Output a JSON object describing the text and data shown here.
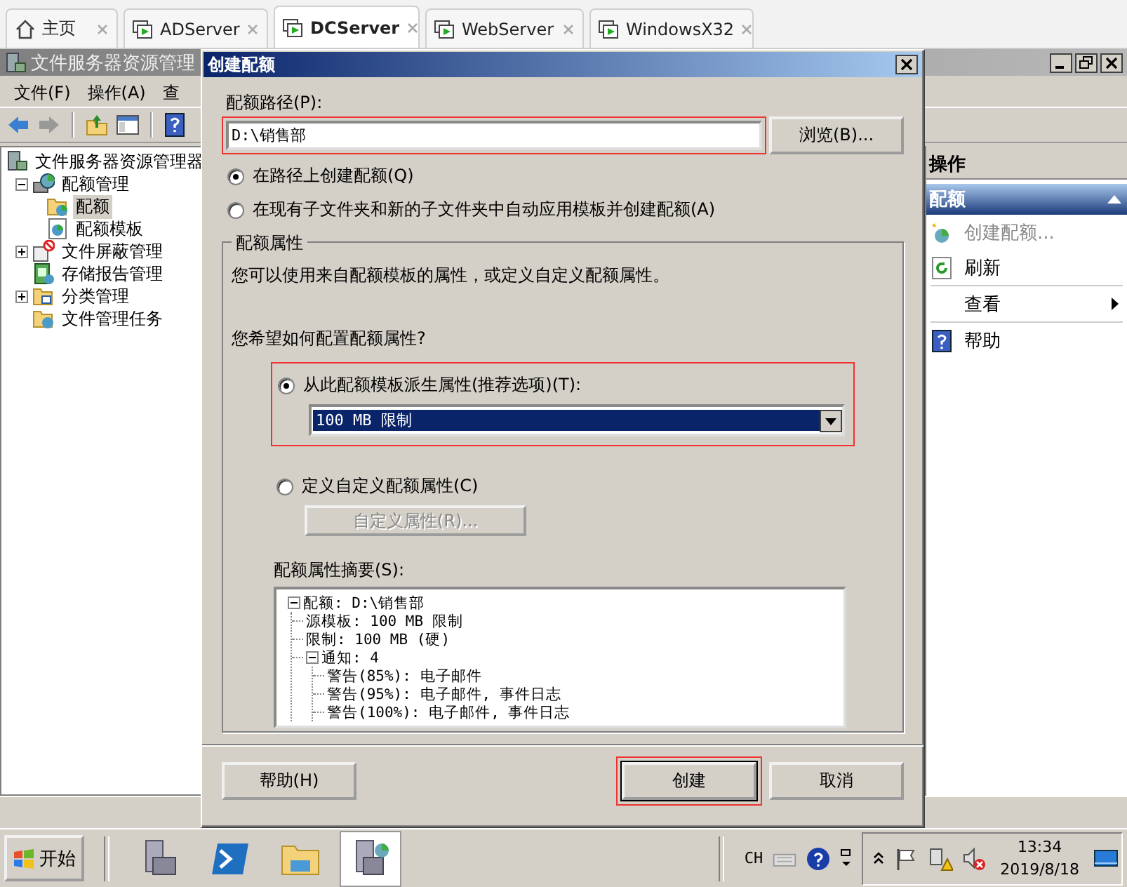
{
  "browser_tabs": [
    {
      "label": "主页",
      "selected": false
    },
    {
      "label": "ADServer",
      "selected": false
    },
    {
      "label": "DCServer",
      "selected": true
    },
    {
      "label": "WebServer",
      "selected": false
    },
    {
      "label": "WindowsX32",
      "selected": false
    }
  ],
  "mmc": {
    "title": "文件服务器资源管理",
    "menu": [
      "文件(F)",
      "操作(A)",
      "查"
    ],
    "tree": [
      {
        "label": "文件服务器资源管理器",
        "selected": false,
        "children": [
          {
            "label": "配额管理",
            "selected": false,
            "expanded": true,
            "children": [
              {
                "label": "配额",
                "selected": true
              },
              {
                "label": "配额模板",
                "selected": false
              }
            ]
          },
          {
            "label": "文件屏蔽管理",
            "selected": false,
            "expanded": false
          },
          {
            "label": "存储报告管理",
            "selected": false
          },
          {
            "label": "分类管理",
            "selected": false,
            "expanded": false
          },
          {
            "label": "文件管理任务",
            "selected": false
          }
        ]
      }
    ],
    "actions": {
      "header": "操作",
      "section": "配额",
      "items": [
        {
          "label": "创建配额...",
          "kind": "item",
          "disabled": true
        },
        {
          "label": "刷新",
          "kind": "item",
          "disabled": false
        },
        {
          "label": "查看",
          "kind": "submenu",
          "disabled": false
        },
        {
          "label": "帮助",
          "kind": "item",
          "disabled": false
        }
      ]
    }
  },
  "dialog": {
    "title": "创建配额",
    "path_label": "配额路径(P):",
    "path_value": "D:\\销售部",
    "path_highlighted": true,
    "browse": "浏览(B)...",
    "scope_options": [
      {
        "label": "在路径上创建配额(Q)",
        "selected": true
      },
      {
        "label": "在现有子文件夹和新的子文件夹中自动应用模板并创建配额(A)",
        "selected": false
      }
    ],
    "group_title": "配额属性",
    "description": "您可以使用来自配额模板的属性，或定义自定义配额属性。",
    "question": "您希望如何配置配额属性?",
    "derive": {
      "label": "从此配额模板派生属性(推荐选项)(T):",
      "selected": true,
      "highlighted": true,
      "template": "100 MB 限制"
    },
    "custom": {
      "label": "定义自定义配额属性(C)",
      "selected": false,
      "button": "自定义属性(R)...",
      "button_disabled": true
    },
    "summary_label": "配额属性摘要(S):",
    "summary": [
      {
        "label": "配额: D:\\销售部",
        "expanded": true,
        "children": [
          {
            "label": "源模板: 100 MB 限制"
          },
          {
            "label": "限制: 100 MB (硬)"
          },
          {
            "label": "通知: 4",
            "expanded": true,
            "children": [
              {
                "label": "警告(85%): 电子邮件"
              },
              {
                "label": "警告(95%): 电子邮件, 事件日志"
              },
              {
                "label": "警告(100%): 电子邮件, 事件日志"
              }
            ]
          }
        ]
      }
    ],
    "help": "帮助(H)",
    "create": "创建",
    "create_highlighted": true,
    "cancel": "取消"
  },
  "taskbar": {
    "start": "开始",
    "apps": [
      {
        "selected": false
      },
      {
        "selected": false
      },
      {
        "selected": false
      },
      {
        "selected": true
      }
    ],
    "input_language": "CH",
    "time": "13:34",
    "date": "2019/8/18"
  }
}
